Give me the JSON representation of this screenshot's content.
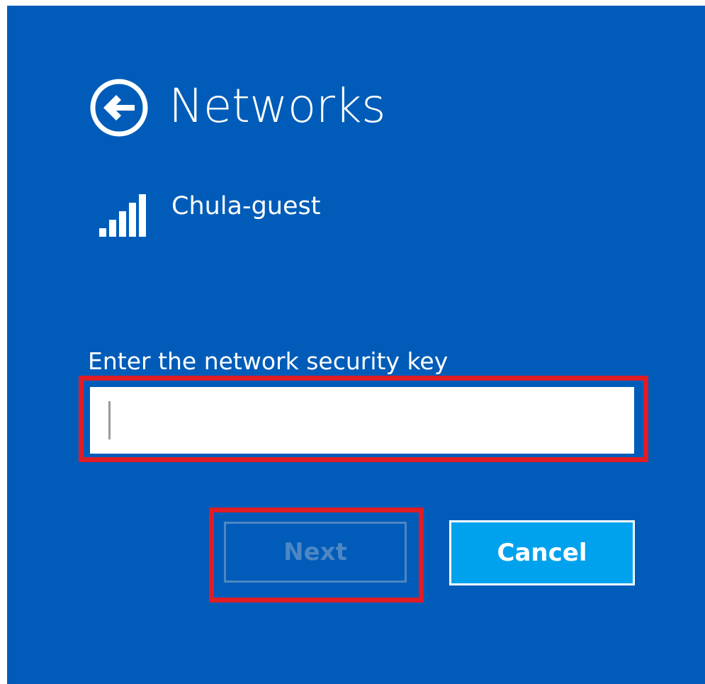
{
  "header": {
    "title": "Networks",
    "back_icon": "back-arrow-circle-icon"
  },
  "network": {
    "name": "Chula-guest",
    "signal_icon": "wifi-signal-icon",
    "signal_strength": "5 of 5 bars"
  },
  "security": {
    "label": "Enter the network security key",
    "value": "",
    "placeholder": ""
  },
  "buttons": {
    "next_label": "Next",
    "next_state": "disabled",
    "cancel_label": "Cancel"
  },
  "colors": {
    "background": "#005cb8",
    "cancel_button": "#00a2ee",
    "disabled_next": "#4d87c4",
    "highlight": "#e01c24"
  }
}
